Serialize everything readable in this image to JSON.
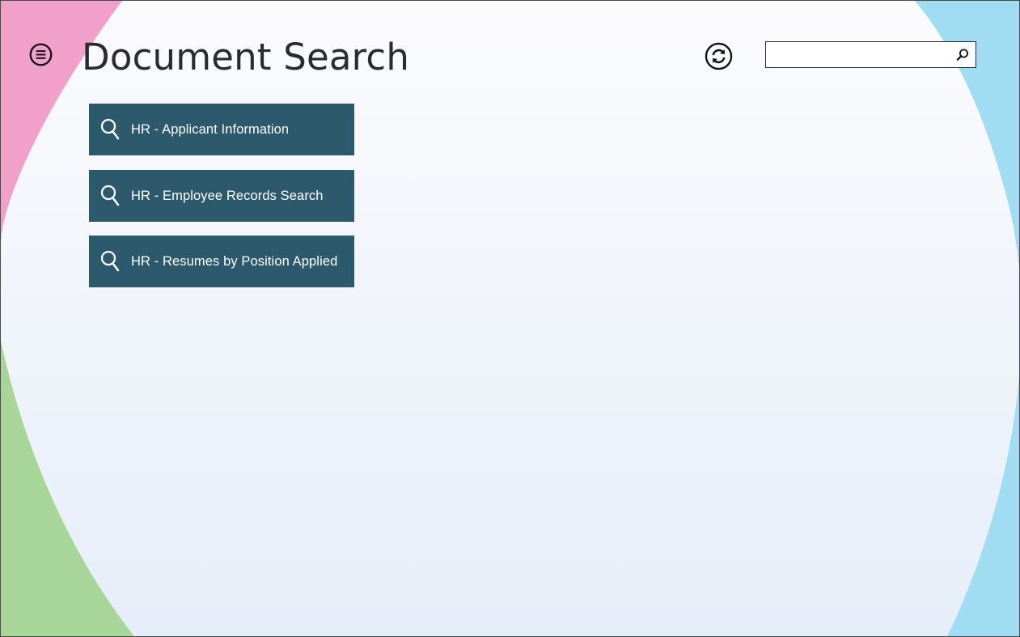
{
  "app": {
    "title": "Document Search"
  },
  "header": {
    "menu_icon": "hamburger-circle-icon",
    "refresh_icon": "refresh-circle-icon",
    "search": {
      "value": "",
      "placeholder": "",
      "icon": "search-icon"
    }
  },
  "searches": [
    {
      "label": "HR - Applicant Information",
      "icon": "search-icon"
    },
    {
      "label": "HR - Employee Records Search",
      "icon": "search-icon"
    },
    {
      "label": "HR - Resumes by Position Applied",
      "icon": "search-icon"
    }
  ],
  "colors": {
    "tile": "#2c5a6c",
    "background": "#f8f9fc",
    "accent_pink": "#f0a3cb",
    "accent_green": "#a9d69b",
    "accent_blue": "#9fdcf1",
    "accent_gray": "#8d8d8d"
  }
}
